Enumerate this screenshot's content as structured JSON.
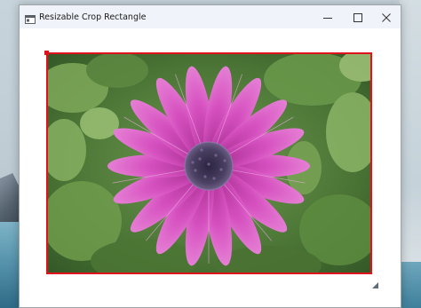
{
  "window": {
    "title": "Resizable Crop Rectangle",
    "app_icon": "window-icon",
    "buttons": {
      "minimize": "minimize-icon",
      "maximize": "maximize-icon",
      "close": "close-icon"
    }
  },
  "image": {
    "subject": "pink-daisy-photo"
  },
  "colors": {
    "crop_border": "#e0131c",
    "titlebar_bg": "#f0f3f9",
    "petal": "#d64fbf",
    "flower_center": "#3e3550",
    "foliage": "#4f7a3a"
  }
}
